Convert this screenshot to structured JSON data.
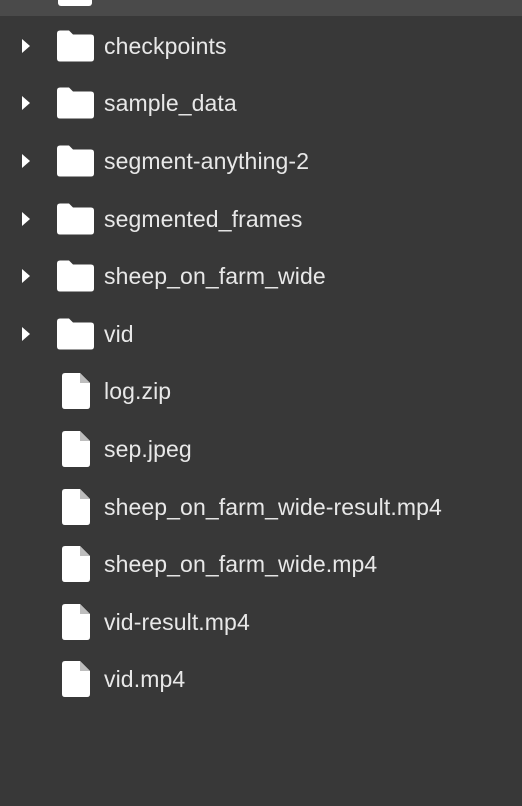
{
  "files": {
    "folders": [
      {
        "name": "checkpoints",
        "icon": "folder-icon"
      },
      {
        "name": "sample_data",
        "icon": "folder-icon"
      },
      {
        "name": "segment-anything-2",
        "icon": "folder-icon"
      },
      {
        "name": "segmented_frames",
        "icon": "folder-icon"
      },
      {
        "name": "sheep_on_farm_wide",
        "icon": "folder-icon"
      },
      {
        "name": "vid",
        "icon": "folder-icon"
      }
    ],
    "items": [
      {
        "name": "log.zip",
        "icon": "file-icon"
      },
      {
        "name": "sep.jpeg",
        "icon": "file-icon"
      },
      {
        "name": "sheep_on_farm_wide-result.mp4",
        "icon": "file-icon"
      },
      {
        "name": "sheep_on_farm_wide.mp4",
        "icon": "file-icon"
      },
      {
        "name": "vid-result.mp4",
        "icon": "file-icon"
      },
      {
        "name": "vid.mp4",
        "icon": "file-icon"
      }
    ]
  },
  "colors": {
    "panel_background": "#383838",
    "top_row_background": "#4a4a4a",
    "text": "#e8e8e8",
    "icon": "#ffffff"
  }
}
